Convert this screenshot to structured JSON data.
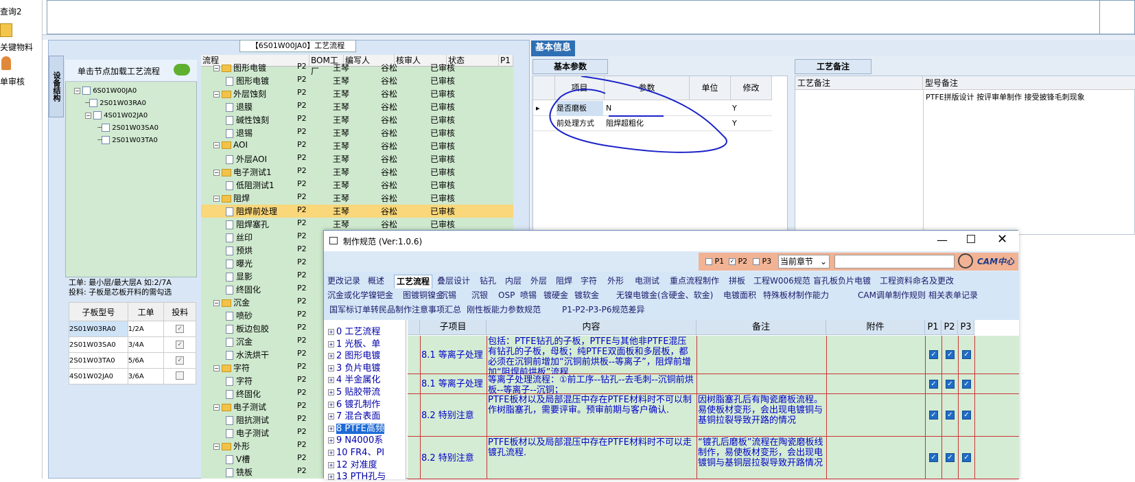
{
  "left_strip": {
    "items": [
      "查询2",
      "关键物料",
      "单审核"
    ]
  },
  "left_panel": {
    "title": "【6S01W00JA0】工艺流程",
    "side_tab": "设备结构",
    "tree_header": "单击节点加载工艺流程",
    "tree": [
      "6S01W00JA0",
      "2S01W03RA0",
      "4S01W02JA0",
      "2S01W03SA0",
      "2S01W03TA0"
    ],
    "info_line1": "工单: 最小层/最大层A 如:2/7A",
    "info_line2": "投料: 子板是芯板开料的需勾选",
    "sub_table": {
      "headers": [
        "子板型号",
        "工单",
        "投料"
      ],
      "rows": [
        [
          "2S01W03RA0",
          "1/2A",
          "✓"
        ],
        [
          "2S01W03SA0",
          "3/4A",
          "✓"
        ],
        [
          "2S01W03TA0",
          "5/6A",
          "✓"
        ],
        [
          "4S01W02JA0",
          "3/6A",
          ""
        ]
      ]
    }
  },
  "process_grid": {
    "headers": [
      "流程",
      "BOM工厂",
      "编写人",
      "核审人",
      "状态",
      "P1"
    ],
    "rows": [
      {
        "name": "图形电镀",
        "level": 1,
        "folder": true,
        "bom": "P2",
        "writer": "王琴",
        "reviewer": "谷松",
        "status": "已审核"
      },
      {
        "name": "图形电镀",
        "level": 2,
        "folder": false,
        "bom": "P2",
        "writer": "王琴",
        "reviewer": "谷松",
        "status": "已审核"
      },
      {
        "name": "外层蚀刻",
        "level": 1,
        "folder": true,
        "bom": "P2",
        "writer": "王琴",
        "reviewer": "谷松",
        "status": "已审核"
      },
      {
        "name": "退膜",
        "level": 2,
        "folder": false,
        "bom": "P2",
        "writer": "王琴",
        "reviewer": "谷松",
        "status": "已审核"
      },
      {
        "name": "碱性蚀刻",
        "level": 2,
        "folder": false,
        "bom": "P2",
        "writer": "王琴",
        "reviewer": "谷松",
        "status": "已审核"
      },
      {
        "name": "退锡",
        "level": 2,
        "folder": false,
        "bom": "P2",
        "writer": "王琴",
        "reviewer": "谷松",
        "status": "已审核"
      },
      {
        "name": "AOI",
        "level": 1,
        "folder": true,
        "bom": "P2",
        "writer": "王琴",
        "reviewer": "谷松",
        "status": "已审核"
      },
      {
        "name": "外层AOI",
        "level": 2,
        "folder": false,
        "bom": "P2",
        "writer": "王琴",
        "reviewer": "谷松",
        "status": "已审核"
      },
      {
        "name": "电子测试1",
        "level": 1,
        "folder": true,
        "bom": "P2",
        "writer": "王琴",
        "reviewer": "谷松",
        "status": "已审核"
      },
      {
        "name": "低阻测试1",
        "level": 2,
        "folder": false,
        "bom": "P2",
        "writer": "王琴",
        "reviewer": "谷松",
        "status": "已审核"
      },
      {
        "name": "阻焊",
        "level": 1,
        "folder": true,
        "bom": "P2",
        "writer": "王琴",
        "reviewer": "谷松",
        "status": "已审核"
      },
      {
        "name": "阻焊前处理",
        "level": 2,
        "folder": false,
        "bom": "P2",
        "writer": "王琴",
        "reviewer": "谷松",
        "status": "已审核",
        "selected": true
      },
      {
        "name": "阻焊塞孔",
        "level": 2,
        "folder": false,
        "bom": "P2",
        "writer": "王琴",
        "reviewer": "谷松",
        "status": "已审核"
      },
      {
        "name": "丝印",
        "level": 2,
        "folder": false,
        "bom": "P2",
        "writer": "",
        "reviewer": "",
        "status": ""
      },
      {
        "name": "预烘",
        "level": 2,
        "folder": false,
        "bom": "P2",
        "writer": "",
        "reviewer": "",
        "status": ""
      },
      {
        "name": "曝光",
        "level": 2,
        "folder": false,
        "bom": "P2",
        "writer": "",
        "reviewer": "",
        "status": ""
      },
      {
        "name": "显影",
        "level": 2,
        "folder": false,
        "bom": "P2",
        "writer": "",
        "reviewer": "",
        "status": ""
      },
      {
        "name": "终固化",
        "level": 2,
        "folder": false,
        "bom": "P2",
        "writer": "",
        "reviewer": "",
        "status": ""
      },
      {
        "name": "沉金",
        "level": 1,
        "folder": true,
        "bom": "P2",
        "writer": "",
        "reviewer": "",
        "status": ""
      },
      {
        "name": "喷砂",
        "level": 2,
        "folder": false,
        "bom": "P2",
        "writer": "",
        "reviewer": "",
        "status": ""
      },
      {
        "name": "板边包胶",
        "level": 2,
        "folder": false,
        "bom": "P2",
        "writer": "",
        "reviewer": "",
        "status": ""
      },
      {
        "name": "沉金",
        "level": 2,
        "folder": false,
        "bom": "P2",
        "writer": "",
        "reviewer": "",
        "status": ""
      },
      {
        "name": "水洗烘干",
        "level": 2,
        "folder": false,
        "bom": "P2",
        "writer": "",
        "reviewer": "",
        "status": ""
      },
      {
        "name": "字符",
        "level": 1,
        "folder": true,
        "bom": "P2",
        "writer": "",
        "reviewer": "",
        "status": ""
      },
      {
        "name": "字符",
        "level": 2,
        "folder": false,
        "bom": "P2",
        "writer": "",
        "reviewer": "",
        "status": ""
      },
      {
        "name": "终固化",
        "level": 2,
        "folder": false,
        "bom": "P2",
        "writer": "",
        "reviewer": "",
        "status": ""
      },
      {
        "name": "电子测试",
        "level": 1,
        "folder": true,
        "bom": "P2",
        "writer": "",
        "reviewer": "",
        "status": ""
      },
      {
        "name": "阻抗测试",
        "level": 2,
        "folder": false,
        "bom": "P2",
        "writer": "",
        "reviewer": "",
        "status": ""
      },
      {
        "name": "电子测试",
        "level": 2,
        "folder": false,
        "bom": "P2",
        "writer": "",
        "reviewer": "",
        "status": ""
      },
      {
        "name": "外形",
        "level": 1,
        "folder": true,
        "bom": "P2",
        "writer": "",
        "reviewer": "",
        "status": ""
      },
      {
        "name": "V槽",
        "level": 2,
        "folder": false,
        "bom": "P2",
        "writer": "",
        "reviewer": "",
        "status": ""
      },
      {
        "name": "铣板",
        "level": 2,
        "folder": false,
        "bom": "P2",
        "writer": "",
        "reviewer": "",
        "status": ""
      }
    ]
  },
  "right_panel": {
    "tab": "基本信息",
    "basic_tab": "基本参数",
    "notes_tab": "工艺备注",
    "basic_headers": [
      "项目",
      "参数",
      "单位",
      "修改"
    ],
    "basic_rows": [
      {
        "item": "是否磨板",
        "param": "N",
        "unit": "",
        "mod": "Y"
      },
      {
        "item": "前处理方式",
        "param": "阻焊超粗化",
        "unit": "",
        "mod": "Y"
      }
    ],
    "notes_headers": [
      "工艺备注",
      "型号备注"
    ],
    "model_note": "PTFE拼版设计  按评审单制作  接受披锋毛刺现象"
  },
  "dialog": {
    "title": "制作规范 (Ver:1.0.6)",
    "toolbar": {
      "p1": "P1",
      "p2": "P2",
      "p3": "P3",
      "chapter_select": "当前章节",
      "search_placeholder": "",
      "logo": "CAM中心"
    },
    "tabs_row1": [
      "更改记录",
      "概述",
      "工艺流程",
      "叠层设计",
      "钻孔",
      "内层",
      "外层",
      "阻焊",
      "字符",
      "外形",
      "电测试",
      "重点流程制作",
      "拼板",
      "工程W006规范",
      "盲孔板负片电镀",
      "工程资料命名及更改"
    ],
    "tabs_row2": [
      "沉金或化学镍钯金",
      "图镀铜镍金",
      "沉锡",
      "沉银",
      "OSP",
      "喷锡",
      "镀硬金",
      "镀软金",
      "无镍电镀金(含硬金、软金)",
      "电镀面积",
      "特殊板材制作能力",
      "CAM调单制作规则",
      "相关表单记录"
    ],
    "tabs_row3": [
      "国军标订单转民品制作注意事项汇总",
      "刚性板能力参数规范",
      "P1-P2-P3-P6规范差异"
    ],
    "active_tab": "工艺流程",
    "tree": [
      "0 工艺流程",
      "1 光板、单",
      "2 图形电镀",
      "3 负片电镀",
      "4 半金属化",
      "5 贴胶带流",
      "6 镀孔制作",
      "7 混合表面",
      "8 PTFE高频",
      "9 N4000系",
      "10 FR4、PI",
      "12 对准度",
      "13 PTH孔与"
    ],
    "grid_headers": [
      "子项目",
      "内容",
      "备注",
      "附件",
      "P1",
      "P2",
      "P3"
    ],
    "grid_rows": [
      {
        "sub": "8.1 等离子处理",
        "content": "包括：PTFE钻孔的子板，PTFE与其他非PTFE混压有钻孔的子板，母板；纯PTFE双面板和多层板，都必须在沉铜前增加“沉铜前烘板--等离子”，阻焊前增加“阻焊前烘板”流程",
        "note": "",
        "p1": true,
        "p2": true,
        "p3": true
      },
      {
        "sub": "8.1 等离子处理",
        "content": "等离子处理流程：①前工序--钻孔--去毛刺--沉铜前烘板--等离子--沉铜；",
        "note": "",
        "p1": true,
        "p2": true,
        "p3": true
      },
      {
        "sub": "8.2 特别注意",
        "content": "PTFE板材以及局部混压中存在PTFE材料时不可以制作树脂塞孔，需要评审。预审前期与客户确认.",
        "note": "因树脂塞孔后有陶瓷磨板流程。易使板材变形，会出现电镀铜与基铜拉裂导致开路的情况",
        "p1": true,
        "p2": true,
        "p3": true
      },
      {
        "sub": "8.2 特别注意",
        "content": "PTFE板材以及局部混压中存在PTFE材料时不可以走镀孔流程.",
        "note": "“镀孔后磨板”流程在陶瓷磨板线制作，易使板材变形，会出现电镀铜与基铜层拉裂导致开路情况",
        "p1": true,
        "p2": true,
        "p3": true
      }
    ]
  }
}
